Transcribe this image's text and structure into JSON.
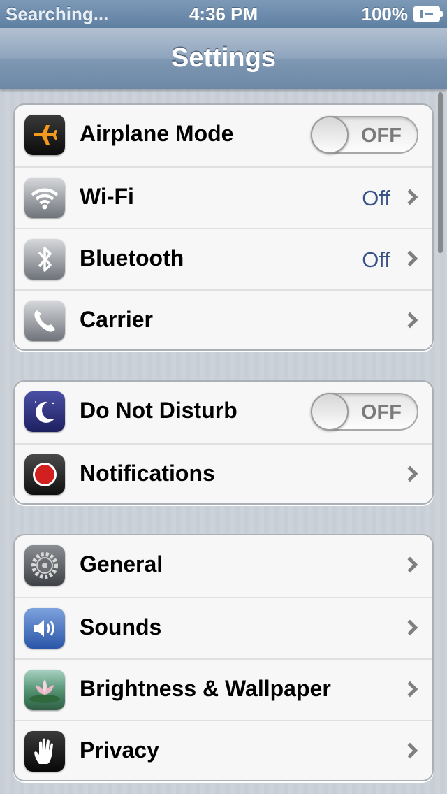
{
  "status_bar": {
    "carrier": "Searching...",
    "time": "4:36 PM",
    "battery": "100%"
  },
  "nav": {
    "title": "Settings"
  },
  "groups": [
    {
      "rows": [
        {
          "label": "Airplane Mode",
          "icon": "airplane-icon",
          "toggle": "OFF"
        },
        {
          "label": "Wi-Fi",
          "icon": "wifi-icon",
          "value": "Off"
        },
        {
          "label": "Bluetooth",
          "icon": "bluetooth-icon",
          "value": "Off"
        },
        {
          "label": "Carrier",
          "icon": "phone-icon"
        }
      ]
    },
    {
      "rows": [
        {
          "label": "Do Not Disturb",
          "icon": "moon-icon",
          "toggle": "OFF"
        },
        {
          "label": "Notifications",
          "icon": "notifications-icon"
        }
      ]
    },
    {
      "rows": [
        {
          "label": "General",
          "icon": "gear-icon"
        },
        {
          "label": "Sounds",
          "icon": "speaker-icon"
        },
        {
          "label": "Brightness & Wallpaper",
          "icon": "lotus-flower-icon"
        },
        {
          "label": "Privacy",
          "icon": "hand-icon"
        }
      ]
    }
  ],
  "colors": {
    "value_text": "#385487",
    "nav_bar": "#7e98b3",
    "background": "#c5ccd4"
  }
}
